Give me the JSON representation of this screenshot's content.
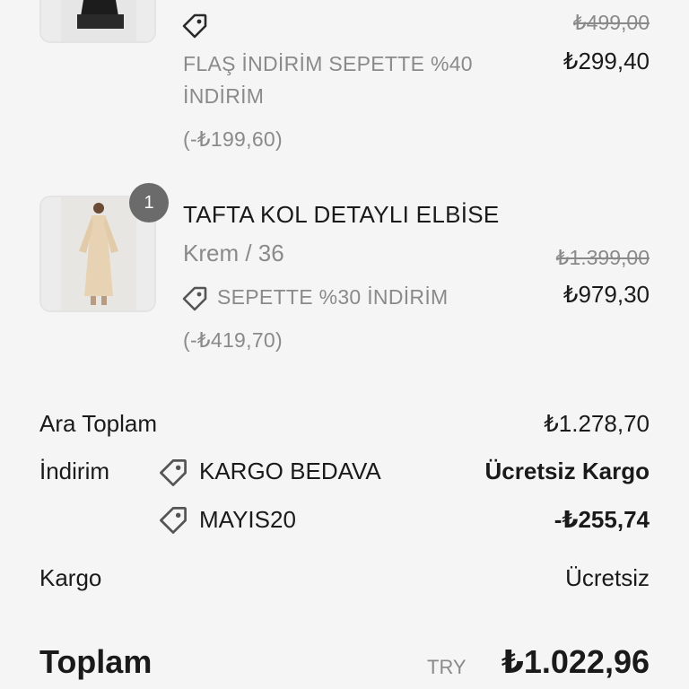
{
  "items": [
    {
      "discount_label": "FLAŞ İNDİRİM SEPETTE %40",
      "discount_label_line2": "İNDİRİM",
      "discount_amount": "(-₺199,60)",
      "original_price": "₺499,00",
      "price": "₺299,40"
    },
    {
      "quantity": "1",
      "name": "TAFTA KOL DETAYLI ELBİSE",
      "variant": "Krem / 36",
      "discount_label": "SEPETTE %30 İNDİRİM",
      "discount_amount": "(-₺419,70)",
      "original_price": "₺1.399,00",
      "price": "₺979,30"
    }
  ],
  "summary": {
    "subtotal_label": "Ara Toplam",
    "subtotal_value": "₺1.278,70",
    "discount_label": "İndirim",
    "discount_codes": [
      {
        "code": "KARGO BEDAVA",
        "value": "Ücretsiz Kargo"
      },
      {
        "code": "MAYIS20",
        "value": "-₺255,74"
      }
    ],
    "shipping_label": "Kargo",
    "shipping_value": "Ücretsiz",
    "total_label": "Toplam",
    "currency": "TRY",
    "total_value": "₺1.022,96"
  },
  "colors": {
    "background": "#f5f5f5",
    "text": "#1a1a1a",
    "muted": "#8a8a8a",
    "badge": "#6b6b6b"
  }
}
